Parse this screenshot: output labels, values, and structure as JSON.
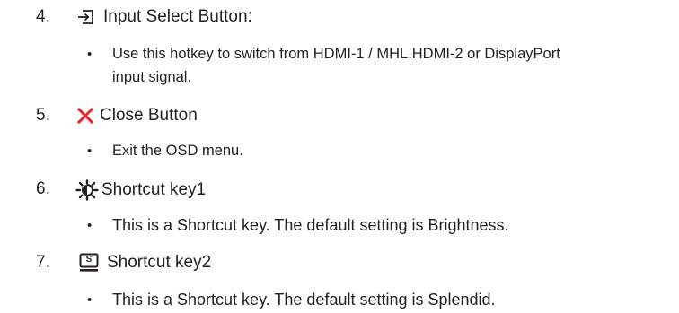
{
  "items": [
    {
      "number": "4.",
      "icon": "input-select-icon",
      "title": "Input Select Button:",
      "bullets": [
        "Use this hotkey to switch from HDMI-1 / MHL,HDMI-2 or DisplayPort",
        "input signal."
      ]
    },
    {
      "number": "5.",
      "icon": "close-x-icon",
      "icon_color": "#e8262b",
      "title": "Close Button",
      "bullets": [
        "Exit the OSD menu."
      ]
    },
    {
      "number": "6.",
      "icon": "brightness-sun-icon",
      "title": "Shortcut key1",
      "bullets": [
        "This is a Shortcut key. The default setting is Brightness."
      ]
    },
    {
      "number": "7.",
      "icon": "splendid-monitor-icon",
      "icon_letter": "S",
      "title": "Shortcut key2",
      "bullets": [
        "This is a Shortcut key. The default setting is Splendid."
      ]
    }
  ],
  "bullet_glyph": "•"
}
